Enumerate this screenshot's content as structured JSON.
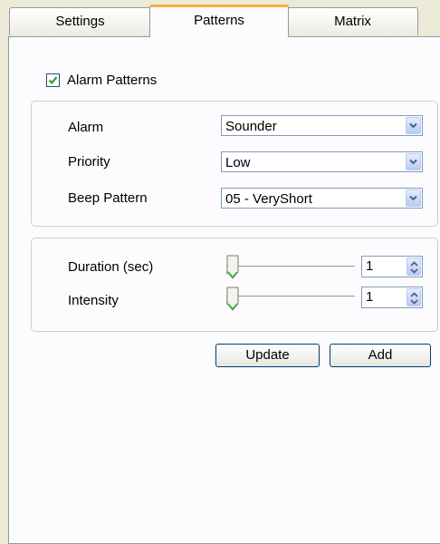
{
  "tabs": [
    {
      "label": "Settings",
      "active": false
    },
    {
      "label": "Patterns",
      "active": true
    },
    {
      "label": "Matrix",
      "active": false
    }
  ],
  "alarm_patterns": {
    "label": "Alarm Patterns",
    "checked": true
  },
  "fields": {
    "alarm": {
      "label": "Alarm",
      "value": "Sounder"
    },
    "priority": {
      "label": "Priority",
      "value": "Low"
    },
    "beep_pattern": {
      "label": "Beep Pattern",
      "value": "05 - VeryShort"
    }
  },
  "sliders": {
    "duration": {
      "label": "Duration (sec)",
      "value": "1",
      "slider_position": 0
    },
    "intensity": {
      "label": "Intensity",
      "value": "1",
      "slider_position": 0
    }
  },
  "buttons": {
    "update": "Update",
    "add": "Add"
  },
  "colors": {
    "active_tab_accent": "#f3b13d",
    "check": "#21a121",
    "window": "#ece9d8"
  }
}
